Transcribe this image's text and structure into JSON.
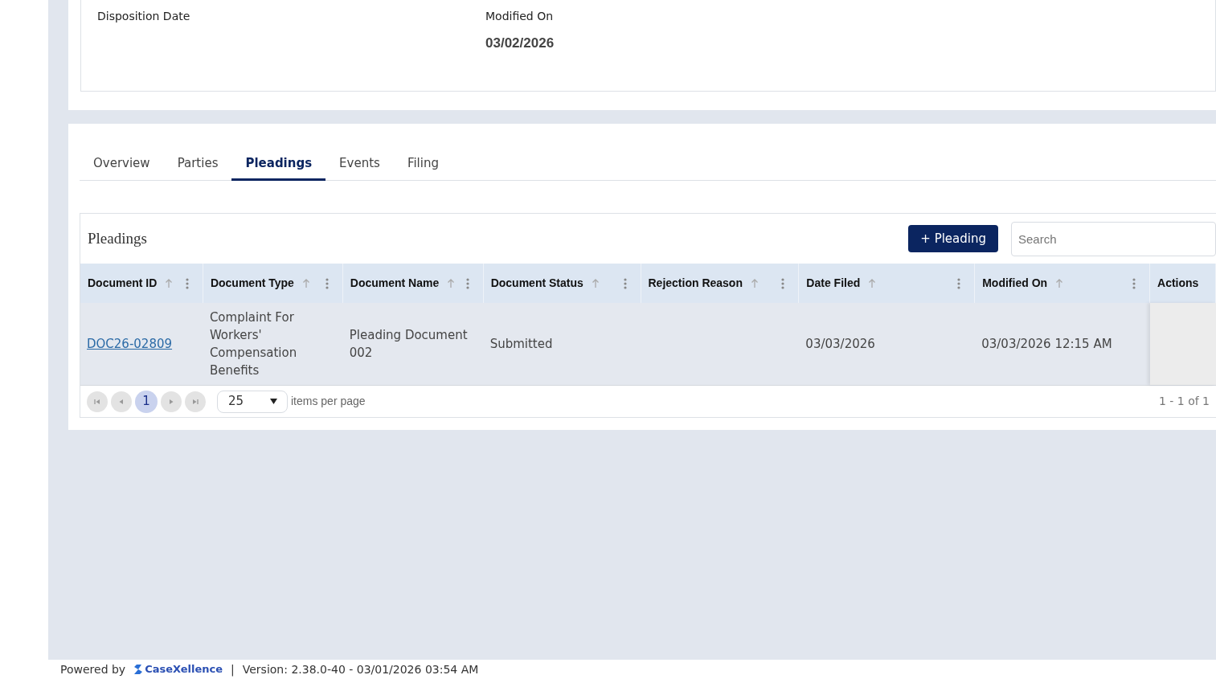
{
  "details": [
    {
      "label": "Disposition Date"
    },
    {
      "label": "Modified On",
      "value": "03/02/2026"
    }
  ],
  "tabs": [
    {
      "label": "Overview",
      "selected": false
    },
    {
      "label": "Parties",
      "selected": false
    },
    {
      "label": "Pleadings",
      "selected": true
    },
    {
      "label": "Events",
      "selected": false
    },
    {
      "label": "Filing",
      "selected": false
    }
  ],
  "panel": {
    "title": "Pleadings",
    "add_button": "+ Pleading",
    "search": {
      "placeholder": "Search"
    }
  },
  "table": {
    "columns": [
      {
        "label": "Document ID",
        "sortable": true,
        "menu": true
      },
      {
        "label": "Document Type",
        "sortable": true,
        "menu": true
      },
      {
        "label": "Document Name",
        "sortable": true,
        "menu": true
      },
      {
        "label": "Document Status",
        "sortable": true,
        "menu": true
      },
      {
        "label": "Rejection Reason",
        "sortable": true,
        "menu": true
      },
      {
        "label": "Date Filed",
        "sortable": true,
        "menu": true
      },
      {
        "label": "Modified On",
        "sortable": true,
        "menu": true
      },
      {
        "label": "Actions",
        "sortable": false,
        "menu": false
      }
    ],
    "rows": [
      {
        "cells": [
          {
            "kind": "link",
            "text": "DOC26-02809"
          },
          {
            "kind": "text",
            "text": "Complaint For Workers' Compensation Benefits"
          },
          {
            "kind": "text",
            "text": "Pleading Document 002"
          },
          {
            "kind": "text",
            "text": "Submitted"
          },
          {
            "kind": "empty"
          },
          {
            "kind": "text",
            "text": "03/03/2026"
          },
          {
            "kind": "text",
            "text": "03/03/2026 12:15 AM"
          },
          {
            "kind": "actions"
          }
        ]
      }
    ]
  },
  "pager": {
    "pages": [
      {
        "label": "1",
        "selected": true
      }
    ],
    "page_size": "25",
    "page_size_label": "items per page",
    "summary": "1 - 1 of 1"
  },
  "footer": {
    "powered_by": "Powered by",
    "brand": "CaseXellence",
    "separator": "|",
    "version": "Version: 2.38.0-40 - 03/01/2026 03:54 AM"
  }
}
